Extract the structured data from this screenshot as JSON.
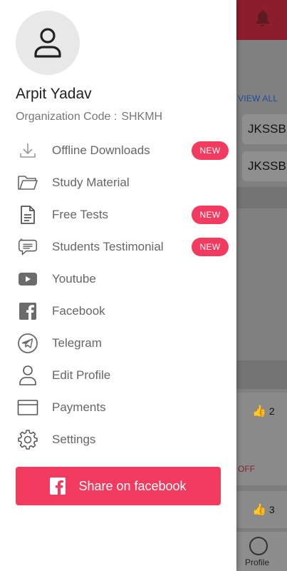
{
  "background": {
    "view_all_label": "VIEW ALL",
    "chips": [
      "JKSSB",
      "JKSSB /"
    ],
    "likes": [
      "2",
      "3"
    ],
    "off_label": "OFF",
    "bottom_nav_profile": "Profile"
  },
  "user": {
    "name": "Arpit Yadav",
    "org_label": "Organization Code :",
    "org_code": "SHKMH"
  },
  "menu": {
    "items": [
      {
        "label": "Offline Downloads",
        "icon": "download-icon",
        "badge": "NEW"
      },
      {
        "label": "Study Material",
        "icon": "folder-icon"
      },
      {
        "label": "Free Tests",
        "icon": "document-icon",
        "badge": "NEW"
      },
      {
        "label": "Students Testimonial",
        "icon": "testimonial-icon",
        "badge": "NEW"
      },
      {
        "label": "Youtube",
        "icon": "youtube-icon"
      },
      {
        "label": "Facebook",
        "icon": "facebook-icon"
      },
      {
        "label": "Telegram",
        "icon": "telegram-icon"
      },
      {
        "label": "Edit Profile",
        "icon": "person-icon"
      },
      {
        "label": "Payments",
        "icon": "card-icon"
      },
      {
        "label": "Settings",
        "icon": "gear-icon"
      }
    ]
  },
  "share": {
    "label": "Share on facebook"
  },
  "colors": {
    "accent": "#f23b5f",
    "topbar": "#8c1d2c",
    "text_primary": "#222222",
    "text_secondary": "#666666"
  }
}
